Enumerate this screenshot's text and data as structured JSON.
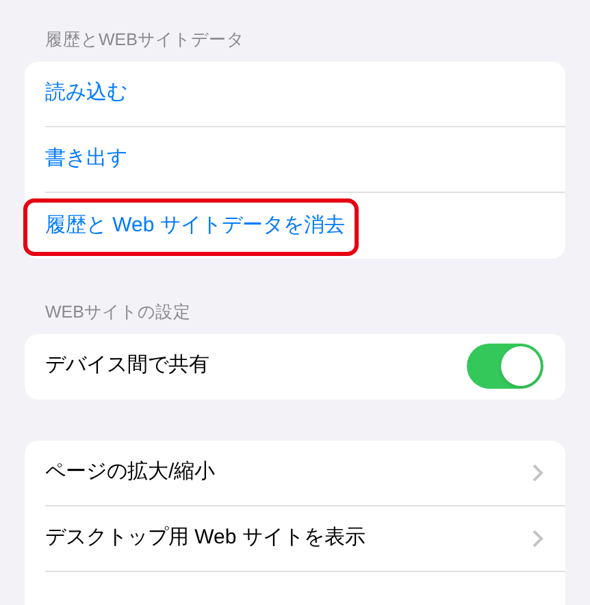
{
  "sections": [
    {
      "header": "履歴とWEBサイトデータ",
      "rows": [
        {
          "kind": "action",
          "label": "読み込む",
          "highlighted": false
        },
        {
          "kind": "action",
          "label": "書き出す",
          "highlighted": false
        },
        {
          "kind": "action",
          "label": "履歴と Web サイトデータを消去",
          "highlighted": true
        }
      ]
    },
    {
      "header": "WEBサイトの設定",
      "rows": [
        {
          "kind": "toggle",
          "label": "デバイス間で共有",
          "on": true
        }
      ]
    },
    {
      "rows": [
        {
          "kind": "link",
          "label": "ページの拡大/縮小"
        },
        {
          "kind": "link",
          "label": "デスクトップ用 Web サイトを表示"
        },
        {
          "kind": "blank"
        }
      ]
    }
  ]
}
